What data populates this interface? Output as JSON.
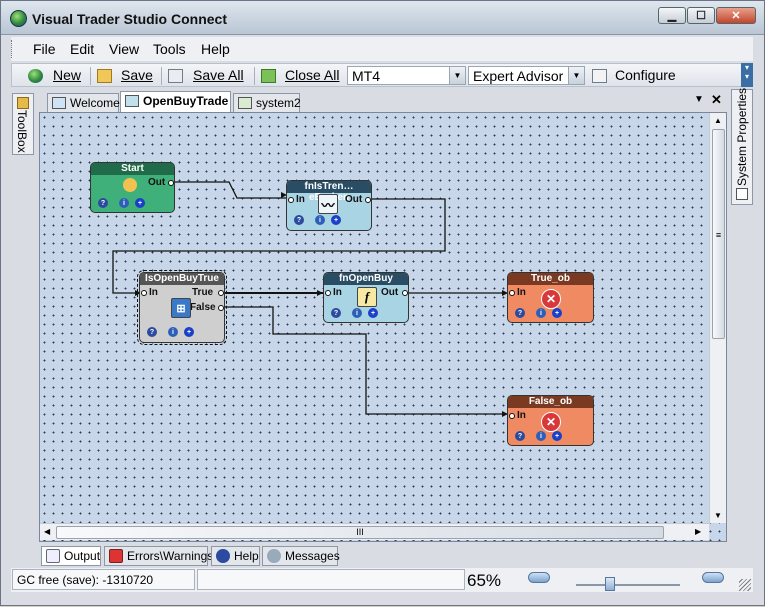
{
  "window": {
    "title": "Visual Trader Studio Connect",
    "min": "▁",
    "max": "☐",
    "close": "✕"
  },
  "menu": [
    "File",
    "Edit",
    "View",
    "Tools",
    "Help"
  ],
  "toolbar": {
    "new": "New",
    "save": "Save",
    "save_all": "Save All",
    "close_all": "Close All",
    "platform": "MT4",
    "target": "Expert Advisor",
    "configure": "Configure"
  },
  "side": {
    "toolbox": "ToolBox",
    "properties": "System Properties"
  },
  "tabs": [
    {
      "label": "Welcome",
      "active": false
    },
    {
      "label": "OpenBuyTrade",
      "active": true
    },
    {
      "label": "system2",
      "active": false
    }
  ],
  "tab_controls": {
    "dropdown": "▼",
    "close": "✕"
  },
  "nodes": {
    "start": {
      "title": "Start",
      "out": "Out"
    },
    "trend": {
      "title": "fnIsTren…eBroken",
      "in": "In",
      "out": "Out"
    },
    "isopen": {
      "title": "IsOpenBuyTrue",
      "in": "In",
      "true": "True",
      "false": "False"
    },
    "openbuy": {
      "title": "fnOpenBuy",
      "in": "In",
      "out": "Out"
    },
    "true_ob": {
      "title": "True_ob",
      "in": "In"
    },
    "false_ob": {
      "title": "False_ob",
      "in": "In"
    }
  },
  "node_buttons": {
    "help": "?",
    "info": "i",
    "add": "+"
  },
  "scroll": {
    "grip": "III",
    "vgrip": "≡"
  },
  "bottom_tabs": [
    "Output",
    "Errors\\Warnings",
    "Help",
    "Messages"
  ],
  "status": {
    "gc": "GC free (save): -1310720",
    "zoom": "65%"
  },
  "colors": {
    "accent": "#3a6ea5",
    "start": "#3fb07a",
    "function": "#a9d4e4",
    "decision": "#cfcfcf",
    "end": "#f08a62"
  }
}
